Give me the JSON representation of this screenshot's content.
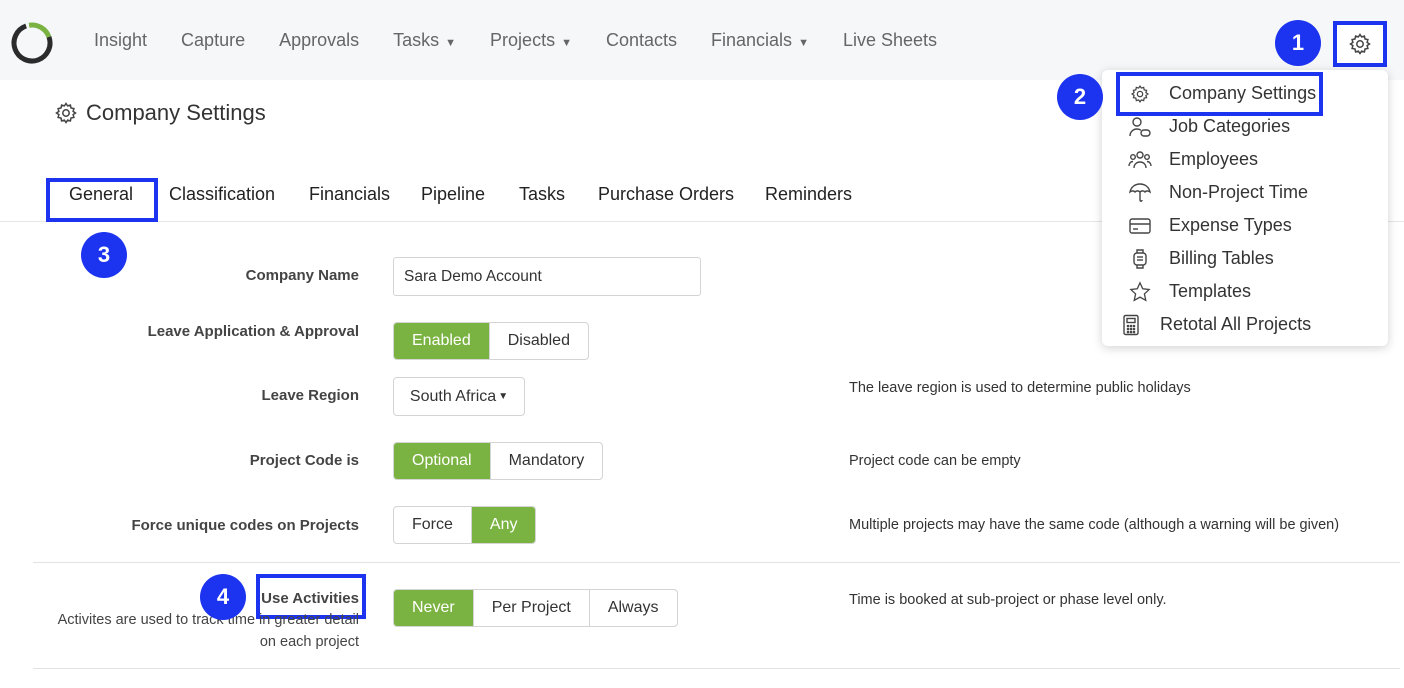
{
  "nav": {
    "items": [
      {
        "label": "Insight",
        "has_caret": false
      },
      {
        "label": "Capture",
        "has_caret": false
      },
      {
        "label": "Approvals",
        "has_caret": false
      },
      {
        "label": "Tasks",
        "has_caret": true
      },
      {
        "label": "Projects",
        "has_caret": true
      },
      {
        "label": "Contacts",
        "has_caret": false
      },
      {
        "label": "Financials",
        "has_caret": true
      },
      {
        "label": "Live Sheets",
        "has_caret": false
      }
    ]
  },
  "page": {
    "title": "Company Settings"
  },
  "tabs": [
    "General",
    "Classification",
    "Financials",
    "Pipeline",
    "Tasks",
    "Purchase Orders",
    "Reminders"
  ],
  "form": {
    "company_name": {
      "label": "Company Name",
      "value": "Sara Demo Account"
    },
    "leave_application": {
      "label": "Leave Application & Approval",
      "options": [
        "Enabled",
        "Disabled"
      ],
      "selected": "Enabled"
    },
    "leave_region": {
      "label": "Leave Region",
      "value": "South Africa",
      "help": "The leave region is used to determine public holidays"
    },
    "project_code": {
      "label": "Project Code is",
      "options": [
        "Optional",
        "Mandatory"
      ],
      "selected": "Optional",
      "help": "Project code can be empty"
    },
    "force_unique": {
      "label": "Force unique codes on Projects",
      "options": [
        "Force",
        "Any"
      ],
      "selected": "Any",
      "help": "Multiple projects may have the same code (although a warning will be given)"
    },
    "use_activities": {
      "label": "Use Activities",
      "sub_help_line1": "Activites are used to track time in greater detail",
      "sub_help_line2": "on each project",
      "options": [
        "Never",
        "Per Project",
        "Always"
      ],
      "selected": "Never",
      "help": "Time is booked at sub-project or phase level only."
    }
  },
  "dropdown": {
    "items": [
      {
        "label": "Company Settings",
        "icon": "gear-icon"
      },
      {
        "label": "Job Categories",
        "icon": "user-tag-icon"
      },
      {
        "label": "Employees",
        "icon": "people-icon"
      },
      {
        "label": "Non-Project Time",
        "icon": "umbrella-icon"
      },
      {
        "label": "Expense Types",
        "icon": "credit-card-icon"
      },
      {
        "label": "Billing Tables",
        "icon": "watch-icon"
      },
      {
        "label": "Templates",
        "icon": "star-icon"
      },
      {
        "label": "Retotal All Projects",
        "icon": "calculator-icon"
      }
    ]
  },
  "badges": [
    "1",
    "2",
    "3",
    "4"
  ],
  "colors": {
    "accent_green": "#7bb342",
    "annotation_blue": "#1c34f0",
    "logo_green": "#7bb342",
    "logo_dark": "#2b2b2b"
  }
}
